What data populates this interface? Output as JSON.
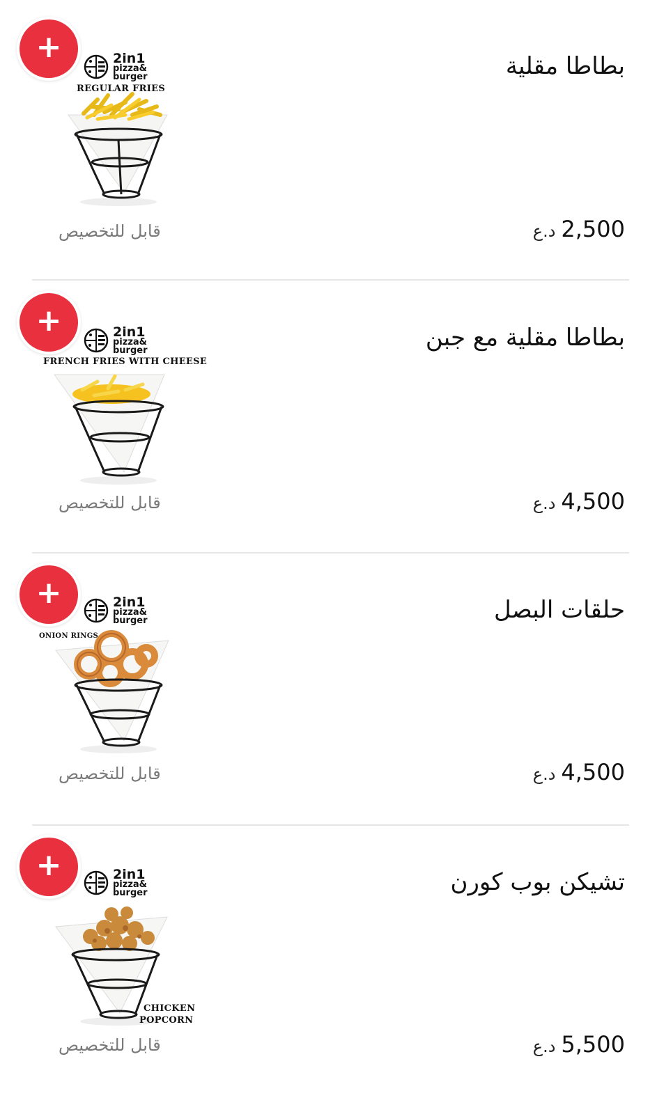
{
  "items": [
    {
      "name": "بطاطا مقلية",
      "price": "2,500",
      "currency": "د.ع",
      "customizable": "قابل للتخصيص",
      "brand": "2in1",
      "brand_sub1": "pizza&",
      "brand_sub2": "burger",
      "label_line1": "REGULAR FRIES",
      "label_line2": "",
      "food": "fries",
      "food_color": "#f7cc2c"
    },
    {
      "name": "بطاطا مقلية مع جبن",
      "price": "4,500",
      "currency": "د.ع",
      "customizable": "قابل للتخصيص",
      "brand": "2in1",
      "brand_sub1": "pizza&",
      "brand_sub2": "burger",
      "label_line1": "FRENCH FRIES WITH CHEESE",
      "label_line2": "",
      "food": "cheese-fries",
      "food_color": "#f6c21f"
    },
    {
      "name": "حلقات البصل",
      "price": "4,500",
      "currency": "د.ع",
      "customizable": "قابل للتخصيص",
      "brand": "2in1",
      "brand_sub1": "pizza&",
      "brand_sub2": "burger",
      "label_line1": "ONION RINGS",
      "label_line2": "",
      "food": "onion-rings",
      "food_color": "#d98a3a"
    },
    {
      "name": "تشيكن بوب كورن",
      "price": "5,500",
      "currency": "د.ع",
      "customizable": "قابل للتخصيص",
      "brand": "2in1",
      "brand_sub1": "pizza&",
      "brand_sub2": "burger",
      "label_line1": "CHICKEN",
      "label_line2": "POPCORN",
      "food": "popcorn-chicken",
      "food_color": "#c98a3c"
    }
  ],
  "colors": {
    "accent": "#e9303f",
    "divider": "#e6e6e6",
    "muted_text": "#7a7a7a"
  },
  "icons": {
    "add": "plus-icon"
  }
}
